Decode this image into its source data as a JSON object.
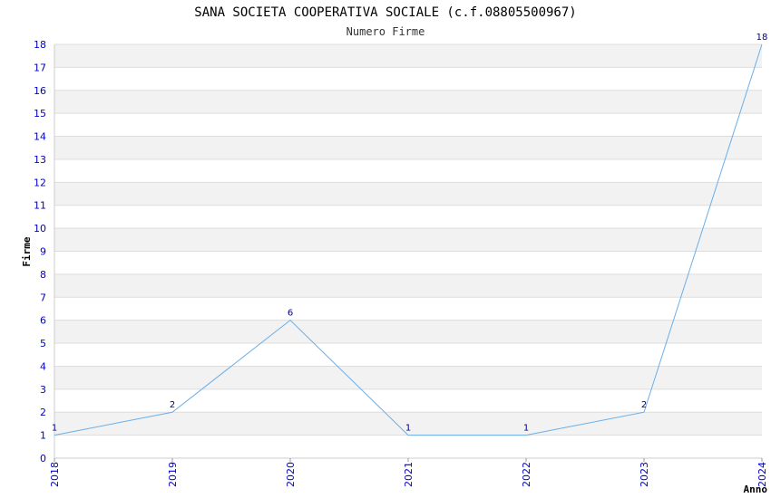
{
  "chart_data": {
    "type": "line",
    "title": "SANA SOCIETA COOPERATIVA SOCIALE (c.f.08805500967)",
    "subtitle": "Numero Firme",
    "xlabel": "Anno",
    "ylabel": "Firme",
    "x": [
      "2018",
      "2019",
      "2020",
      "2021",
      "2022",
      "2023",
      "2024"
    ],
    "series": [
      {
        "values": [
          1,
          2,
          6,
          1,
          1,
          2,
          18
        ]
      }
    ],
    "ylim": [
      0,
      18
    ],
    "yticks": [
      0,
      1,
      2,
      3,
      4,
      5,
      6,
      7,
      8,
      9,
      10,
      11,
      12,
      13,
      14,
      15,
      16,
      17,
      18
    ],
    "grid": "horizontal alternating bands",
    "colors": {
      "line": "#6aaee8",
      "band": "#f2f2f2",
      "gridline": "#dddddd",
      "tick_text": "#0000cc",
      "label_text": "#000080"
    }
  }
}
